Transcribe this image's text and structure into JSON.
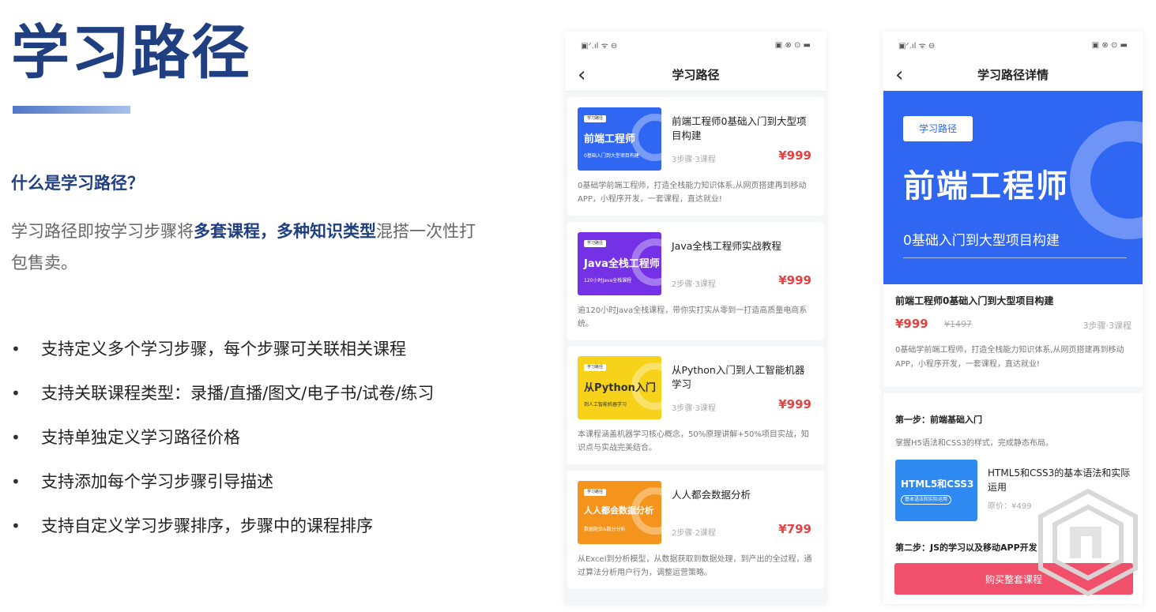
{
  "slide": {
    "title": "学习路径",
    "question": "什么是学习路径？",
    "desc_part1": "学习路径即按学习步骤将",
    "desc_highlight": "多套课程，多种知识类型",
    "desc_part2": "混搭一次性打包售卖。",
    "bullet": "•",
    "features": [
      "支持定义多个学习步骤，每个步骤可关联相关课程",
      "支持关联课程类型：录播/直播/图文/电子书/试卷/练习",
      "支持单独定义学习路径价格",
      "支持添加每个学习步骤引导描述",
      "支持自定义学习步骤排序，步骤中的课程排序"
    ]
  },
  "list_phone": {
    "status_left": "▣ᐟ.ıl ᯤ ⊖",
    "status_right": "▣ ⊗ ⊙ ▬",
    "back": "‹",
    "nav_title": "学习路径",
    "courses": [
      {
        "cover_tag": "学习路径",
        "cover_main": "前端工程师",
        "cover_sub": "0基础入门到大型项目构建",
        "cover_color": "#2f66f2",
        "title": "前端工程师0基础入门到大型项目构建",
        "meta": "3步骤·3课程",
        "price": "¥999",
        "desc": "0基础学前端工程师，打造全栈能力知识体系,从网页搭建再到移动APP，小程序开发，一套课程，直达就业!"
      },
      {
        "cover_tag": "学习路径",
        "cover_main": "Java全栈工程师",
        "cover_sub": "120小时Java全栈课程",
        "cover_color": "#7431e6",
        "title": "Java全栈工程师实战教程",
        "meta": "2步骤·3课程",
        "price": "¥999",
        "desc": "逾120小时Java全栈课程，带你实打实从零到一打造高质量电商系统。"
      },
      {
        "cover_tag": "学习路径",
        "cover_main": "从Python入门",
        "cover_sub": "到人工智能机器学习",
        "cover_color": "#f7d21a",
        "title": "从Python入门到人工智能机器学习",
        "meta": "3步骤·3课程",
        "price": "¥999",
        "desc": "本课程涵盖机器学习核心概念，50%原理讲解+50%项目实战，知识点与实战完美结合。"
      },
      {
        "cover_tag": "学习路径",
        "cover_main": "人人都会数据分析",
        "cover_sub": "数据爬虫&数分分析",
        "cover_color": "#f5941d",
        "title": "人人都会数据分析",
        "meta": "2步骤·2课程",
        "price": "¥799",
        "desc": "从Excel到分析模型，从数据获取到数据处理，到产出的全过程，通过算法分析用户行为，调整运营策略。"
      }
    ]
  },
  "detail_phone": {
    "status_left": "▣ᐟ.ıl ᯤ ⊖",
    "status_right": "▣ ⊗ ⊙ ▬",
    "back": "‹",
    "nav_title": "学习路径详情",
    "hero_tag": "学习路径",
    "hero_main": "前端工程师",
    "hero_sub": "0基础入门到大型项目构建",
    "hero_color": "#2f66f2",
    "title": "前端工程师0基础入门到大型项目构建",
    "price": "¥999",
    "orig_price": "¥1497",
    "meta": "3步骤·3课程",
    "desc": "0基础学前端工程师，打造全栈能力知识体系,从网页搭建再到移动APP，小程序开发，一套课程，直达就业!",
    "step1_title": "第一步：前端基础入门",
    "step1_desc": "掌握H5语法和CSS3的样式，完成静态布局。",
    "step_course_cover_main": "HTML5和CSS3",
    "step_course_cover_sub": "基本语法和实际运用",
    "step_course_title": "HTML5和CSS3的基本语法和实际运用",
    "step_course_price": "原价：¥499",
    "step2_title": "第二步：JS的学习以及移动APP开发",
    "buy_label": "购买整套课程",
    "buy_color": "#f0506a"
  }
}
